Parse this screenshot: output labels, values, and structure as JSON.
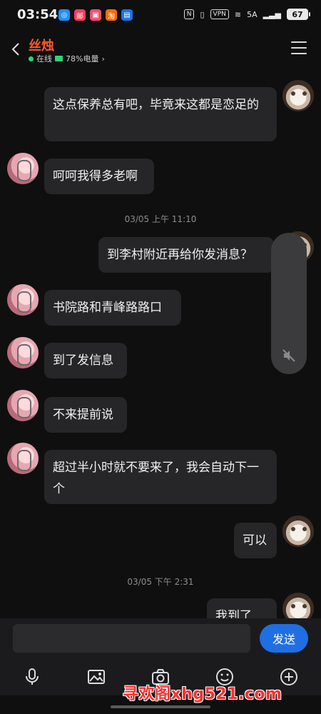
{
  "status_bar": {
    "time": "03:54",
    "network": "VPN",
    "signal": "5A",
    "battery": "67",
    "app_icons": [
      {
        "name": "app-icon-1",
        "color": "#1e90ff",
        "glyph": "◎"
      },
      {
        "name": "app-icon-2",
        "color": "#ff3b57",
        "glyph": "邮"
      },
      {
        "name": "app-icon-3",
        "color": "#ff4b6e",
        "glyph": "▣"
      },
      {
        "name": "app-icon-4",
        "color": "#ff6a00",
        "glyph": "淘"
      },
      {
        "name": "app-icon-5",
        "color": "#1a73e8",
        "glyph": "▤"
      }
    ]
  },
  "header": {
    "name": "丝烛",
    "status": "在线",
    "battery_text": "78%电量",
    "accent": "#ff5a2a"
  },
  "messages": [
    {
      "side": "me",
      "text": "这点保养总有吧，毕竟来这都是恋足的"
    },
    {
      "side": "her",
      "text": "呵呵我得多老啊"
    },
    {
      "type": "time",
      "text": "03/05 上午 11:10"
    },
    {
      "side": "me",
      "text": "到李村附近再给你发消息？"
    },
    {
      "side": "her",
      "text": "书院路和青峰路路口"
    },
    {
      "side": "her",
      "text": "到了发信息"
    },
    {
      "side": "her",
      "text": "不来提前说"
    },
    {
      "side": "her",
      "text": "超过半小时就不要来了，我会自动下一个"
    },
    {
      "side": "me",
      "text": "可以"
    },
    {
      "type": "time",
      "text": "03/05 下午 2:31"
    },
    {
      "side": "me",
      "text": "我到了"
    }
  ],
  "input": {
    "placeholder": "",
    "send_label": "发送"
  },
  "toolbar": [
    "mic-icon",
    "image-icon",
    "camera-icon",
    "emoji-icon",
    "plus-icon"
  ],
  "watermark": "寻欢阁xhg521.com"
}
